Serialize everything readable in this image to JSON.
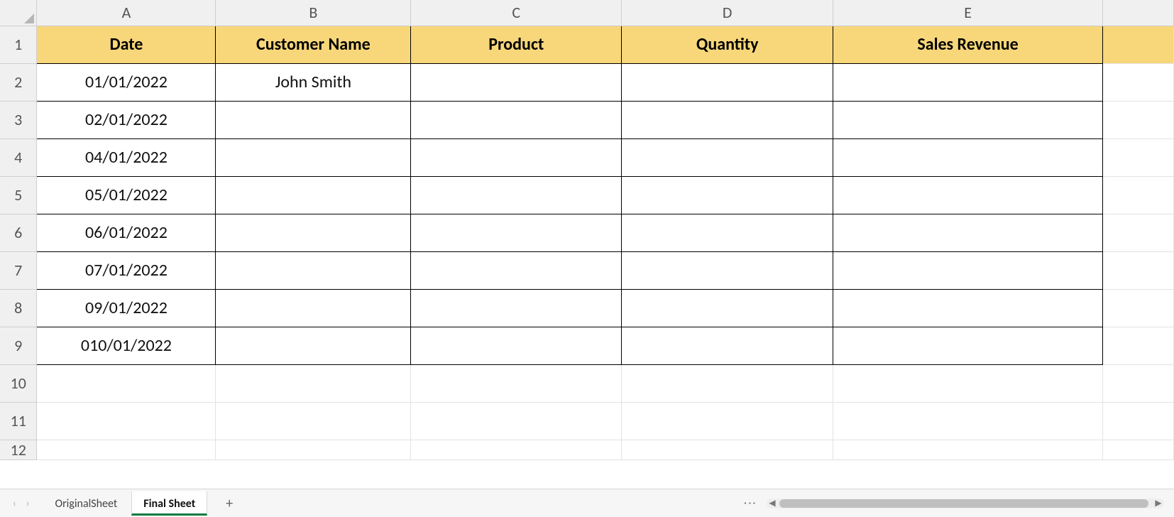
{
  "columns": [
    "A",
    "B",
    "C",
    "D",
    "E"
  ],
  "row_labels": [
    "1",
    "2",
    "3",
    "4",
    "5",
    "6",
    "7",
    "8",
    "9",
    "10",
    "11",
    "12"
  ],
  "header_row": {
    "A": "Date",
    "B": "Customer Name",
    "C": "Product",
    "D": "Quantity",
    "E": "Sales Revenue"
  },
  "data_rows": [
    {
      "A": "01/01/2022",
      "B": "John Smith",
      "C": "",
      "D": "",
      "E": ""
    },
    {
      "A": "02/01/2022",
      "B": "",
      "C": "",
      "D": "",
      "E": ""
    },
    {
      "A": "04/01/2022",
      "B": "",
      "C": "",
      "D": "",
      "E": ""
    },
    {
      "A": "05/01/2022",
      "B": "",
      "C": "",
      "D": "",
      "E": ""
    },
    {
      "A": "06/01/2022",
      "B": "",
      "C": "",
      "D": "",
      "E": ""
    },
    {
      "A": "07/01/2022",
      "B": "",
      "C": "",
      "D": "",
      "E": ""
    },
    {
      "A": "09/01/2022",
      "B": "",
      "C": "",
      "D": "",
      "E": ""
    },
    {
      "A": "010/01/2022",
      "B": "",
      "C": "",
      "D": "",
      "E": ""
    }
  ],
  "tabs": [
    {
      "label": "OriginalSheet",
      "active": false
    },
    {
      "label": "Final Sheet",
      "active": true
    }
  ],
  "colors": {
    "header_fill": "#f7d77a",
    "accent": "#107c41"
  }
}
